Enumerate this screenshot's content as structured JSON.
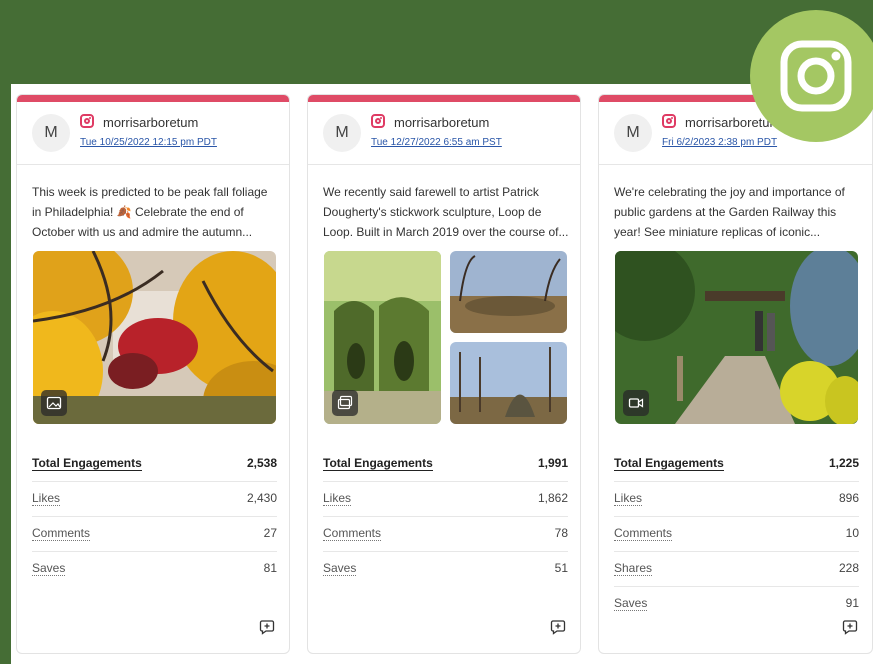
{
  "app": {
    "badge_icon": "instagram-icon",
    "badge_color": "#a4c763",
    "accent": "#df4b66"
  },
  "posts": [
    {
      "avatar": "M",
      "account": "morrisarboretum",
      "date": "Tue 10/25/2022 12:15 pm PDT",
      "caption": [
        "This week is predicted to be peak fall foliage",
        "in Philadelphia! 🍂 Celebrate the end of",
        "October with us and admire the autumn..."
      ],
      "media_type": "image-icon",
      "metrics": [
        {
          "label": "Total Engagements",
          "value": "2,538"
        },
        {
          "label": "Likes",
          "value": "2,430"
        },
        {
          "label": "Comments",
          "value": "27"
        },
        {
          "label": "Saves",
          "value": "81"
        }
      ]
    },
    {
      "avatar": "M",
      "account": "morrisarboretum",
      "date": "Tue 12/27/2022 6:55 am PST",
      "caption": [
        "We recently said farewell to artist Patrick",
        "Dougherty's stickwork sculpture, Loop de",
        "Loop. Built in March 2019 over the course of..."
      ],
      "media_type": "gallery-icon",
      "metrics": [
        {
          "label": "Total Engagements",
          "value": "1,991"
        },
        {
          "label": "Likes",
          "value": "1,862"
        },
        {
          "label": "Comments",
          "value": "78"
        },
        {
          "label": "Saves",
          "value": "51"
        }
      ]
    },
    {
      "avatar": "M",
      "account": "morrisarboretum",
      "date": "Fri 6/2/2023 2:38 pm PDT",
      "caption": [
        "We're celebrating the joy and importance of",
        "public gardens at the Garden Railway this",
        "year! See miniature replicas of iconic..."
      ],
      "media_type": "video-icon",
      "metrics": [
        {
          "label": "Total Engagements",
          "value": "1,225"
        },
        {
          "label": "Likes",
          "value": "896"
        },
        {
          "label": "Comments",
          "value": "10"
        },
        {
          "label": "Shares",
          "value": "228"
        },
        {
          "label": "Saves",
          "value": "91"
        }
      ]
    }
  ]
}
